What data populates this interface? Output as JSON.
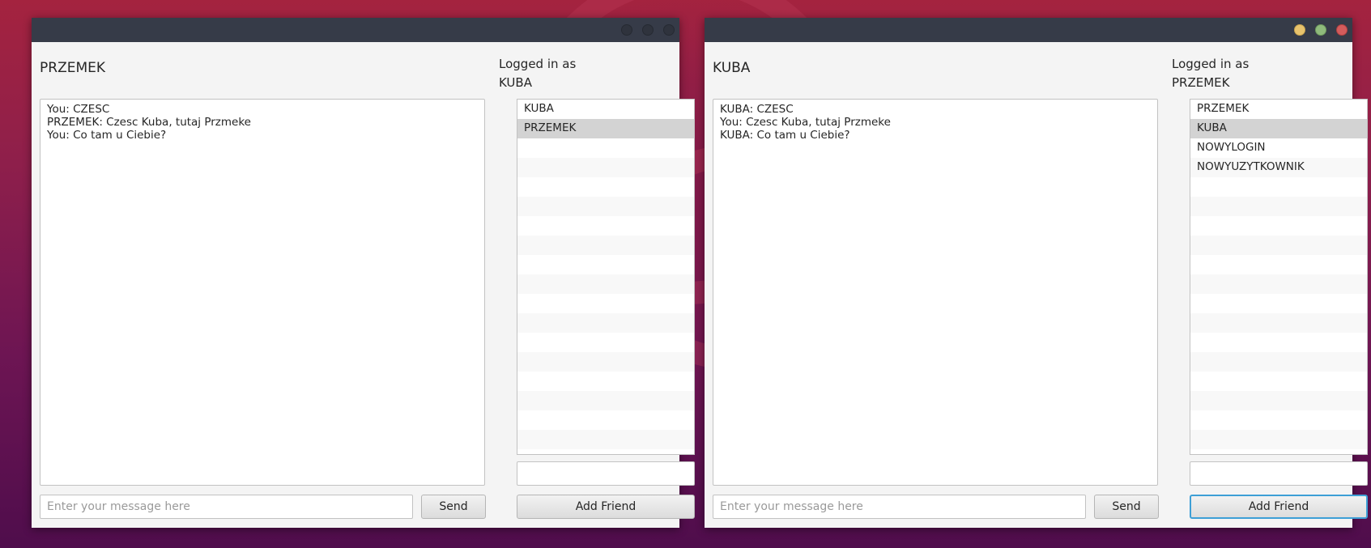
{
  "windows": [
    {
      "friend_name": "PRZEMEK",
      "logged_in_label": "Logged in as",
      "logged_in_user": "KUBA",
      "messages": [
        "You: CZESC",
        "PRZEMEK: Czesc Kuba, tutaj Przmeke",
        "You: Co tam u Ciebie?"
      ],
      "friends": [
        "KUBA",
        "PRZEMEK"
      ],
      "selected_friend": "PRZEMEK",
      "message_placeholder": "Enter your message here",
      "send_label": "Send",
      "add_friend_label": "Add Friend",
      "add_friend_input_value": ""
    },
    {
      "friend_name": "KUBA",
      "logged_in_label": "Logged in as",
      "logged_in_user": "PRZEMEK",
      "messages": [
        "KUBA: CZESC",
        "You: Czesc Kuba, tutaj Przmeke",
        "KUBA: Co tam u Ciebie?"
      ],
      "friends": [
        "PRZEMEK",
        "KUBA",
        "NOWYLOGIN",
        "NOWYUZYTKOWNIK"
      ],
      "selected_friend": "KUBA",
      "message_placeholder": "Enter your message here",
      "send_label": "Send",
      "add_friend_label": "Add Friend",
      "add_friend_input_value": ""
    }
  ],
  "colors": {
    "titlebar": "#363b48",
    "window_bg": "#f4f4f4",
    "selected_row": "#d3d3d3",
    "focus_ring": "#3d9fd6",
    "minimize_button": "#e8c36d",
    "maximize_button": "#8fba7c",
    "close_button": "#d35c5c"
  },
  "icons": [
    "minimize-icon",
    "maximize-icon",
    "close-icon"
  ]
}
